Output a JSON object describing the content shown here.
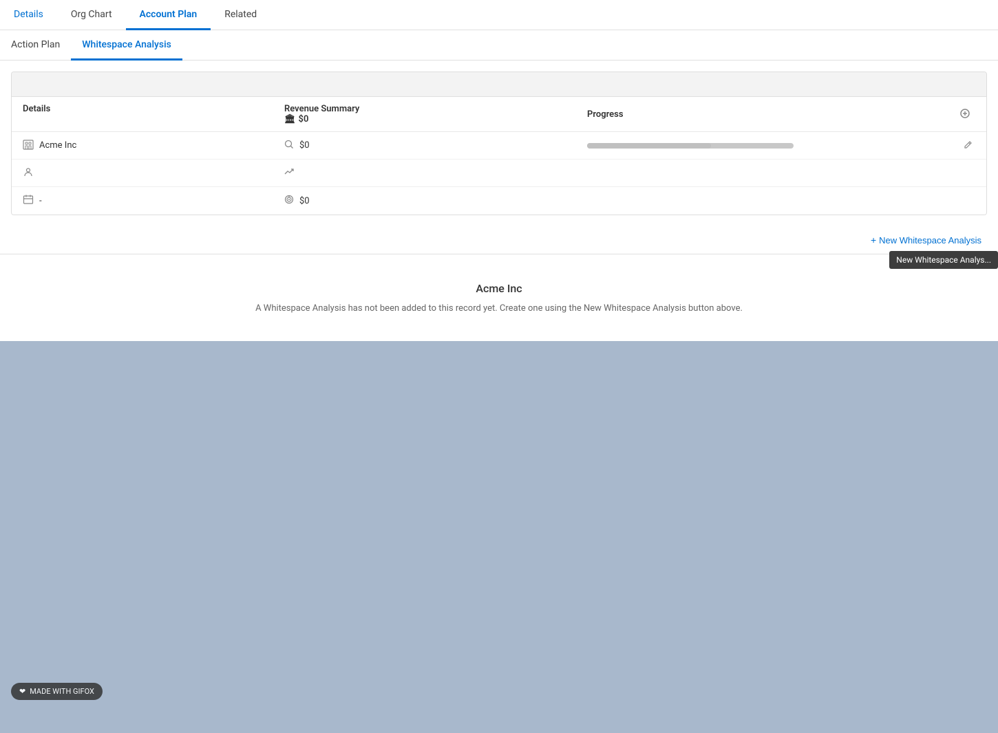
{
  "topNav": {
    "items": [
      {
        "id": "details",
        "label": "Details",
        "active": false
      },
      {
        "id": "org-chart",
        "label": "Org Chart",
        "active": false
      },
      {
        "id": "account-plan",
        "label": "Account Plan",
        "active": true
      },
      {
        "id": "related",
        "label": "Related",
        "active": false
      }
    ]
  },
  "subTabs": {
    "items": [
      {
        "id": "action-plan",
        "label": "Action Plan",
        "active": false
      },
      {
        "id": "whitespace-analysis",
        "label": "Whitespace Analysis",
        "active": true
      }
    ]
  },
  "table": {
    "columns": {
      "details": "Details",
      "revenueSummary": "Revenue Summary",
      "revenueAmount": "$0",
      "progress": "Progress"
    },
    "rows": [
      {
        "detailsIcon": "building",
        "detailsText": "Acme Inc",
        "revenueIcon": "search",
        "revenueValue": "$0",
        "progressValue": 60
      },
      {
        "detailsIcon": "person",
        "detailsText": "",
        "revenueIcon": "trending",
        "revenueValue": "",
        "progressValue": 0
      },
      {
        "detailsIcon": "calendar",
        "detailsText": "-",
        "revenueIcon": "target",
        "revenueValue": "$0",
        "progressValue": 0
      }
    ]
  },
  "buttons": {
    "newWhitespaceAnalysis": "New Whitespace Analysis"
  },
  "tooltip": {
    "text": "New Whitespace Analys..."
  },
  "emptyState": {
    "title": "Acme Inc",
    "message": "A Whitespace Analysis has not been added to this record yet. Create one using the New Whitespace Analysis button above."
  },
  "watermark": {
    "text": "MADE WITH GIFOX"
  }
}
